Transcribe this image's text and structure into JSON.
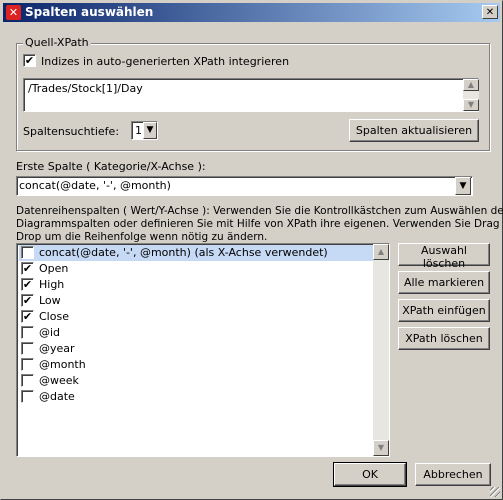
{
  "window": {
    "title": "Spalten auswählen",
    "close_glyph": "✕"
  },
  "source_group": {
    "legend": "Quell-XPath",
    "integrate_indices": {
      "label": "Indizes in auto-generierten XPath integrieren",
      "checked": true
    },
    "xpath_value": "/Trades/Stock[1]/Day",
    "depth_label": "Spaltensuchtiefe:",
    "depth_value": "1",
    "refresh_button": "Spalten aktualisieren"
  },
  "first_column": {
    "label": "Erste Spalte ( Kategorie/X-Achse ):",
    "value": "concat(@date, '-', @month)"
  },
  "series": {
    "description_line1": "Datenreihenspalten ( Wert/Y-Achse ): Verwenden Sie die Kontrollkästchen zum Auswählen der",
    "description_line2": "Diagrammspalten oder definieren Sie mit Hilfe von XPath ihre eigenen. Verwenden Sie Drag &",
    "description_line3": "Drop um die Reihenfolge wenn nötig zu ändern.",
    "items": [
      {
        "label": "concat(@date, '-', @month) (als X-Achse verwendet)",
        "checked": false,
        "selected": true
      },
      {
        "label": "Open",
        "checked": true,
        "selected": false
      },
      {
        "label": "High",
        "checked": true,
        "selected": false
      },
      {
        "label": "Low",
        "checked": true,
        "selected": false
      },
      {
        "label": "Close",
        "checked": true,
        "selected": false
      },
      {
        "label": "@id",
        "checked": false,
        "selected": false
      },
      {
        "label": "@year",
        "checked": false,
        "selected": false
      },
      {
        "label": "@month",
        "checked": false,
        "selected": false
      },
      {
        "label": "@week",
        "checked": false,
        "selected": false
      },
      {
        "label": "@date",
        "checked": false,
        "selected": false
      }
    ]
  },
  "side_buttons": {
    "clear_selection": "Auswahl löschen",
    "select_all": "Alle markieren",
    "insert_xpath": "XPath einfügen",
    "delete_xpath": "XPath löschen"
  },
  "footer": {
    "ok": "OK",
    "cancel": "Abbrechen"
  },
  "icons": {
    "app": "x-logo-icon",
    "checkmark": "✔",
    "arrow_down": "▼",
    "arrow_up": "▲"
  }
}
